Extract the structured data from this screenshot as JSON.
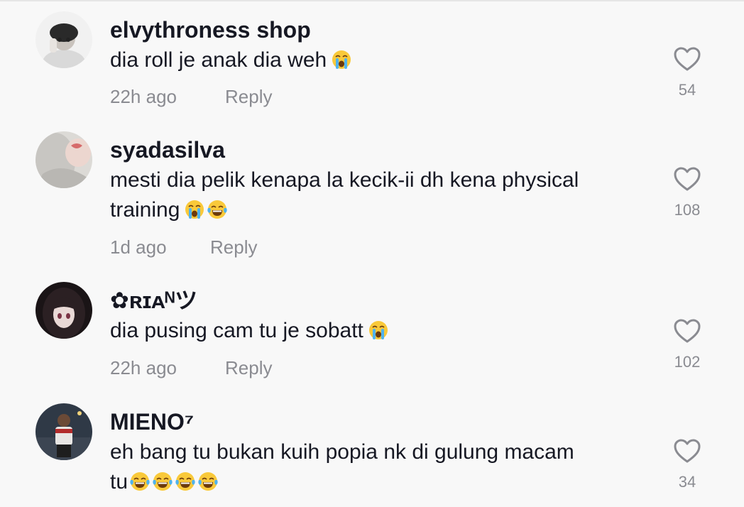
{
  "comments": [
    {
      "username": "elvythroness shop",
      "text": "dia roll je anak dia weh",
      "emojis": [
        "loudly-crying-face"
      ],
      "time": "22h ago",
      "reply": "Reply",
      "likes": "54"
    },
    {
      "username": "syadasilva",
      "text_line1": "mesti dia pelik kenapa la kecik-ii dh kena physical",
      "text_line2": "training",
      "emojis": [
        "loudly-crying-face",
        "face-with-tears-of-joy"
      ],
      "time": "1d ago",
      "reply": "Reply",
      "likes": "108"
    },
    {
      "username": "✿ʀɪᴀᴺツ",
      "text": "dia pusing cam tu je sobatt",
      "emojis": [
        "loudly-crying-face"
      ],
      "time": "22h ago",
      "reply": "Reply",
      "likes": "102"
    },
    {
      "username": "MIENO⁷",
      "text_line1": "eh bang tu bukan kuih popia nk di gulung macam",
      "text_line2": "tu",
      "emojis": [
        "face-with-tears-of-joy",
        "face-with-tears-of-joy",
        "face-with-tears-of-joy",
        "face-with-tears-of-joy"
      ],
      "time": "",
      "reply": "",
      "likes": "34"
    }
  ],
  "colors": {
    "background": "#f8f8f8",
    "username": "#161823",
    "text": "#161823",
    "muted": "#8a8b91",
    "heart_stroke": "#8a8b91"
  },
  "icons": {
    "like": "heart-outline-icon"
  }
}
